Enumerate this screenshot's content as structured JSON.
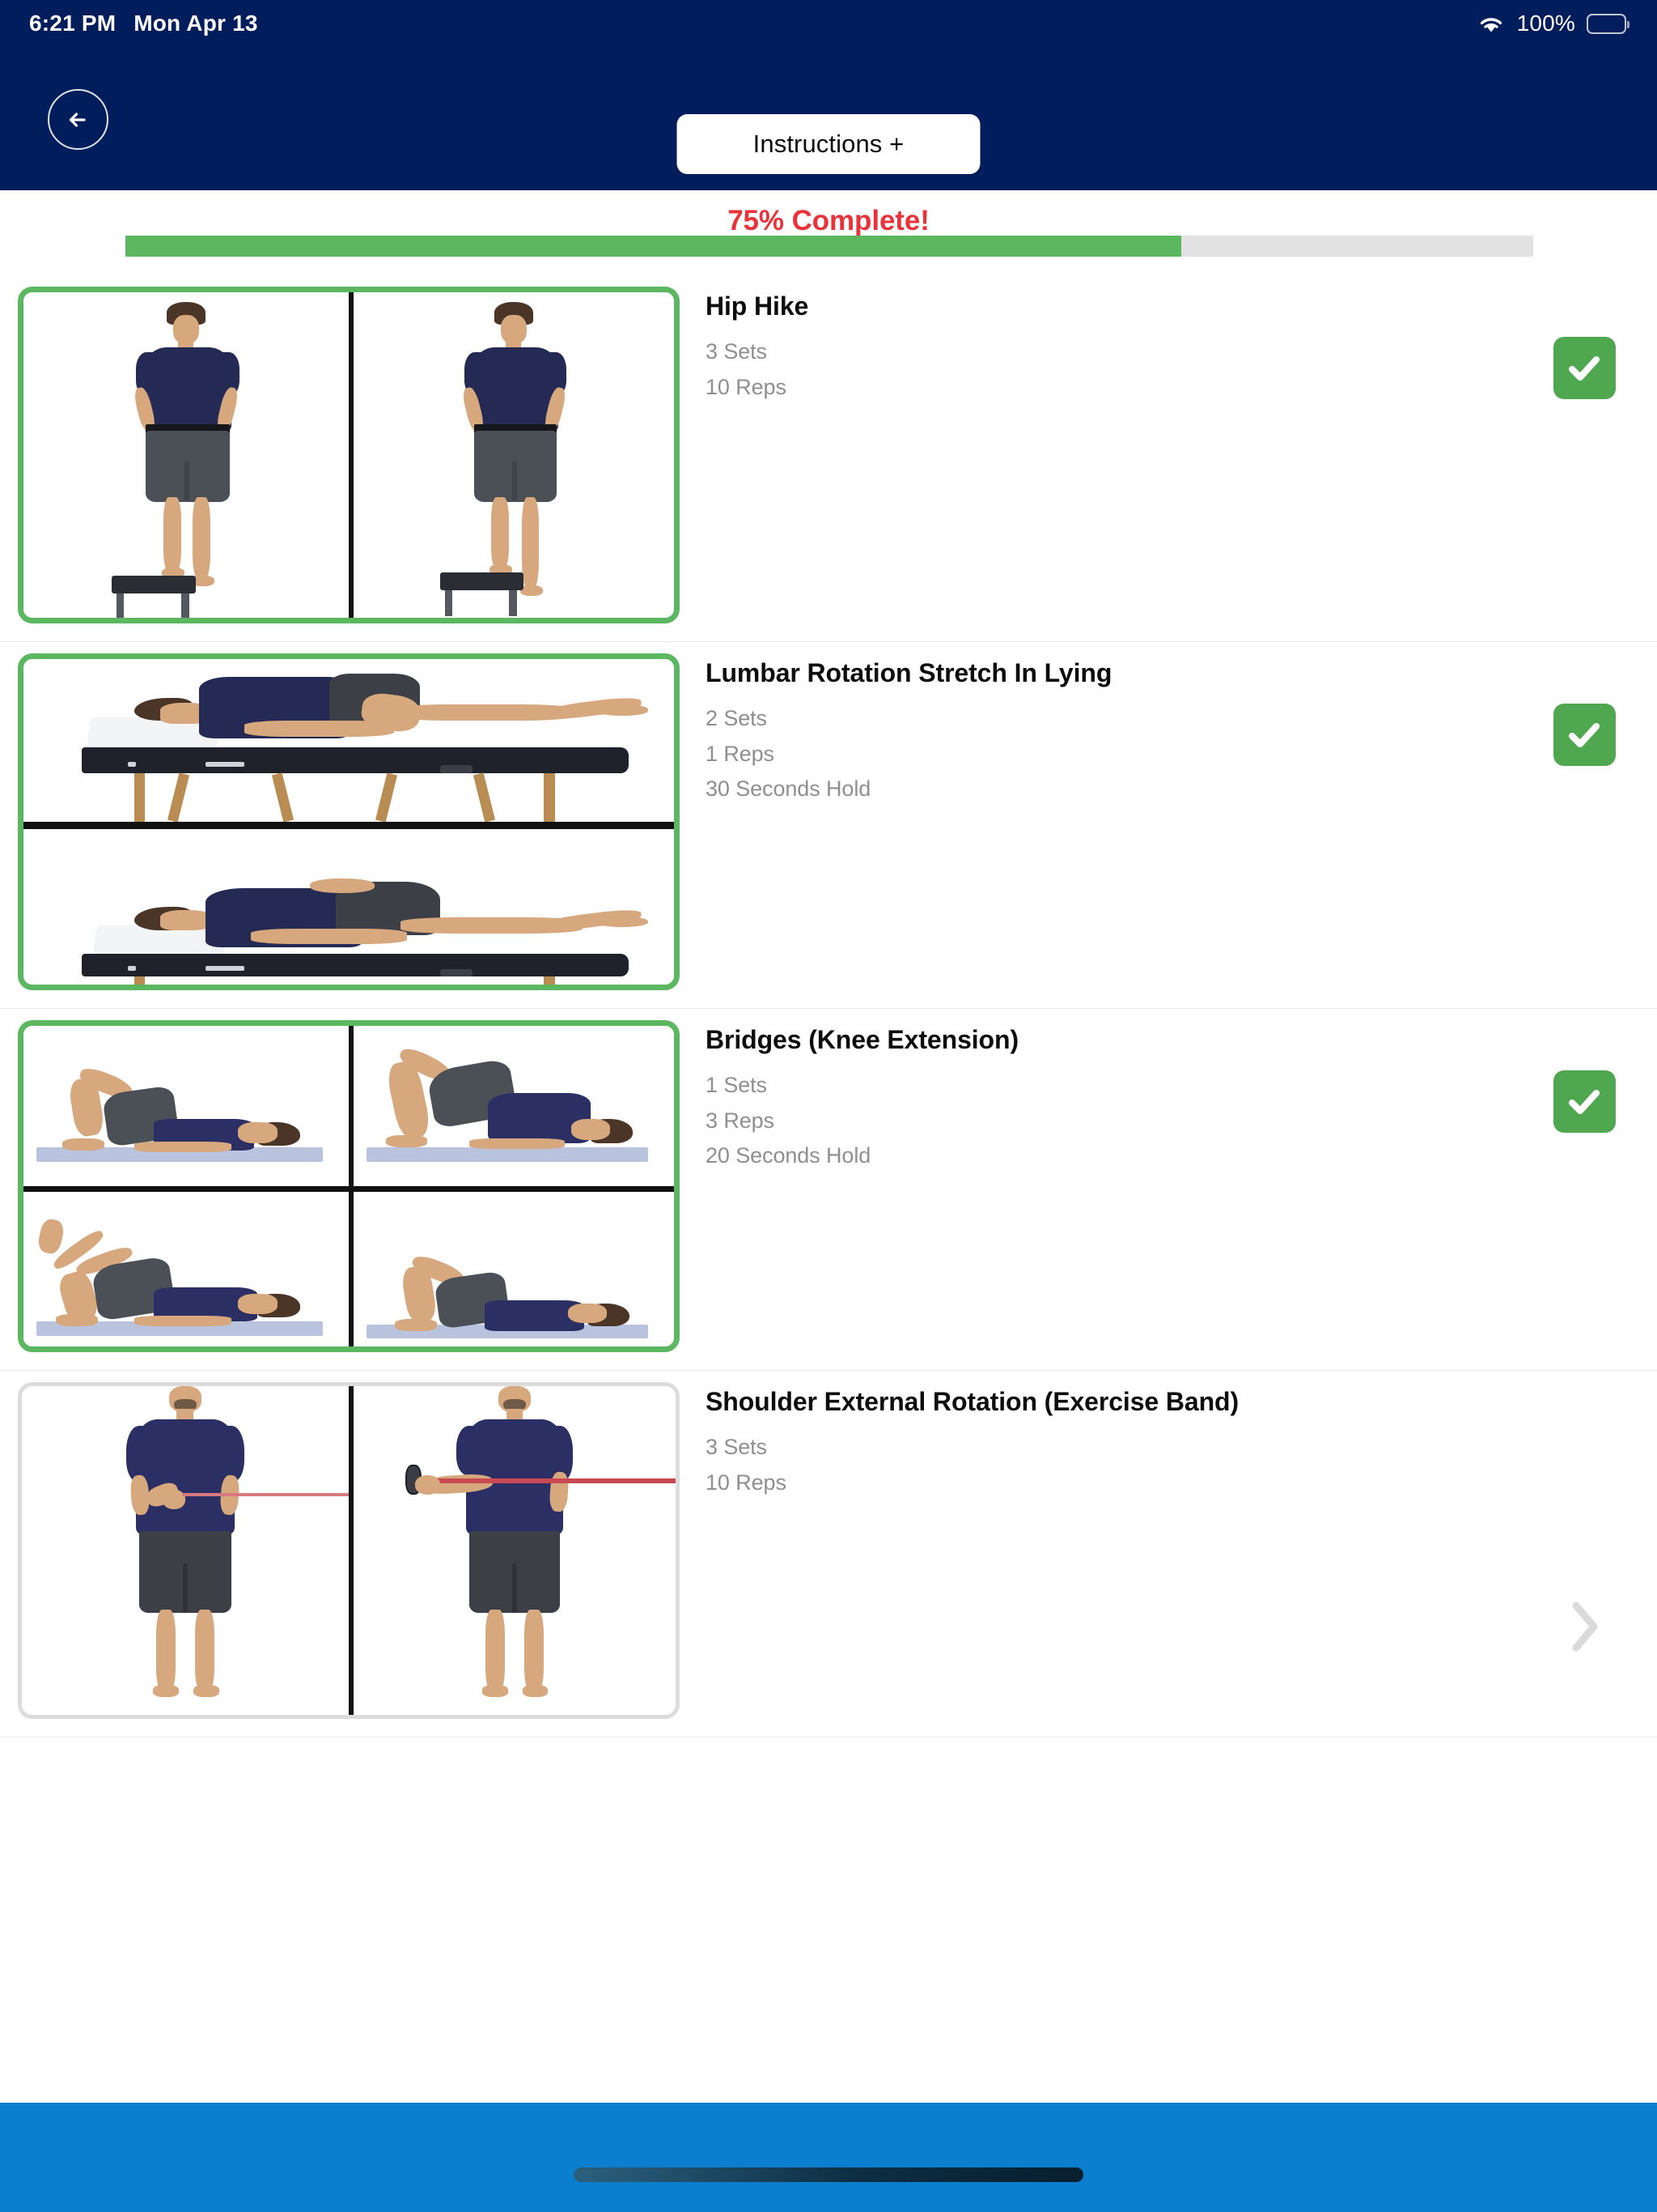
{
  "status_bar": {
    "time": "6:21 PM",
    "date": "Mon Apr 13",
    "battery_percent": "100%",
    "wifi_icon": "wifi-icon",
    "battery_icon": "battery-full-icon"
  },
  "header": {
    "back_icon": "arrow-left-icon",
    "instructions_label": "Instructions +"
  },
  "progress": {
    "label": "75% Complete!",
    "percent": 75,
    "fill_color": "#5cb860",
    "track_color": "#e2e2e2",
    "label_color": "#e8333a"
  },
  "exercises": [
    {
      "title": "Hip Hike",
      "sets": "3 Sets",
      "reps": "10 Reps",
      "hold": "",
      "status": "complete",
      "status_icon": "check-icon",
      "thumb_layout": "cols2",
      "thumb_border": "green"
    },
    {
      "title": "Lumbar Rotation Stretch In Lying",
      "sets": "2 Sets",
      "reps": "1 Reps",
      "hold": "30 Seconds Hold",
      "status": "complete",
      "status_icon": "check-icon",
      "thumb_layout": "rows2",
      "thumb_border": "green"
    },
    {
      "title": "Bridges (Knee Extension)",
      "sets": "1 Sets",
      "reps": "3 Reps",
      "hold": "20 Seconds Hold",
      "status": "complete",
      "status_icon": "check-icon",
      "thumb_layout": "grid2x2",
      "thumb_border": "green"
    },
    {
      "title": "Shoulder External Rotation (Exercise Band)",
      "sets": "3 Sets",
      "reps": "10 Reps",
      "hold": "",
      "status": "incomplete",
      "status_icon": "chevron-right-icon",
      "thumb_layout": "cols2",
      "thumb_border": "gray"
    }
  ],
  "colors": {
    "header_navy": "#021d5c",
    "bottom_blue": "#0b7fcd",
    "check_green": "#4fa84f",
    "border_green": "#5cb860",
    "muted_text": "#8f8f8f"
  },
  "bottom_bar": {
    "home_indicator": "home-indicator"
  }
}
